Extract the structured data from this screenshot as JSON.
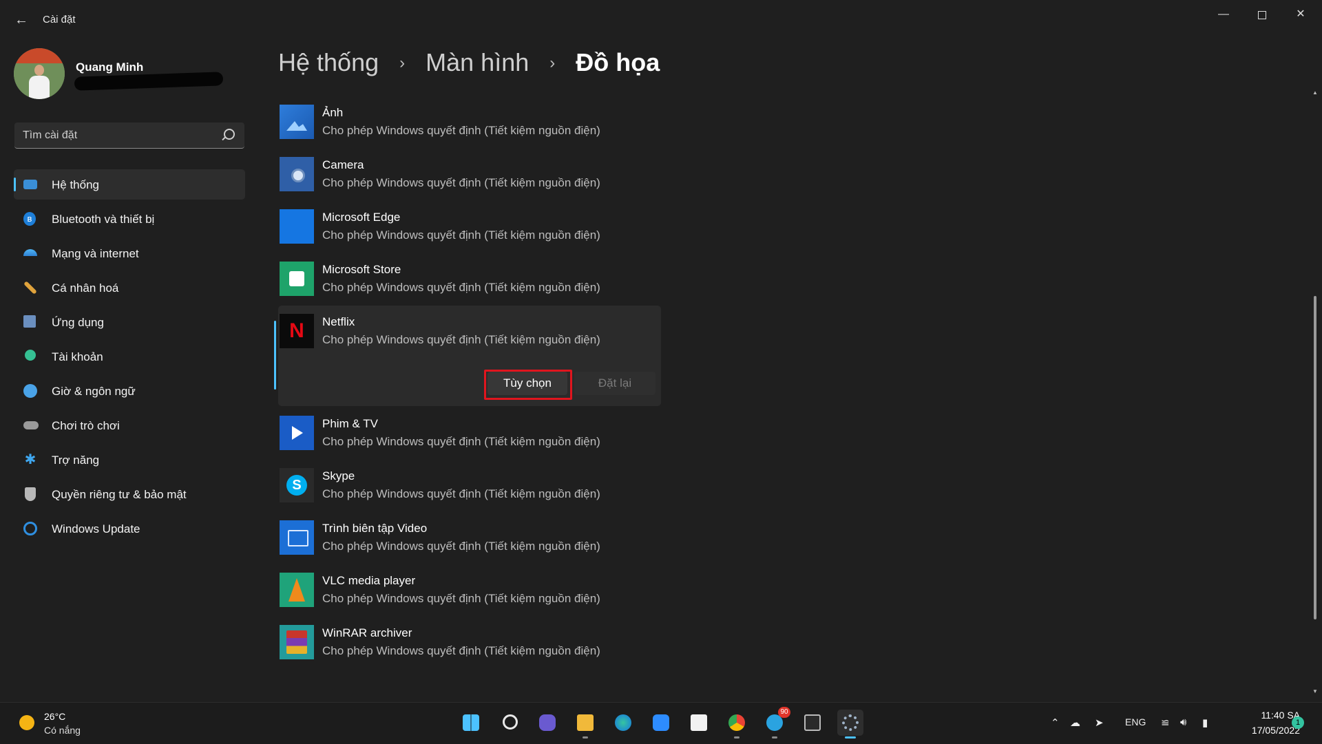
{
  "window": {
    "title": "Cài đặt",
    "back_icon": "arrow-left-icon"
  },
  "profile": {
    "name": "Quang Minh"
  },
  "search": {
    "placeholder": "Tìm cài đặt"
  },
  "sidebar": {
    "items": [
      {
        "label": "Hệ thống",
        "icon": "monitor-icon",
        "active": true
      },
      {
        "label": "Bluetooth và thiết bị",
        "icon": "bluetooth-icon"
      },
      {
        "label": "Mạng và internet",
        "icon": "wifi-icon"
      },
      {
        "label": "Cá nhân hoá",
        "icon": "brush-icon"
      },
      {
        "label": "Ứng dụng",
        "icon": "apps-icon"
      },
      {
        "label": "Tài khoản",
        "icon": "account-icon"
      },
      {
        "label": "Giờ & ngôn ngữ",
        "icon": "globe-clock-icon"
      },
      {
        "label": "Chơi trò chơi",
        "icon": "gamepad-icon"
      },
      {
        "label": "Trợ năng",
        "icon": "accessibility-icon"
      },
      {
        "label": "Quyền riêng tư & bảo mật",
        "icon": "shield-icon"
      },
      {
        "label": "Windows Update",
        "icon": "update-icon"
      }
    ]
  },
  "breadcrumb": {
    "items": [
      "Hệ thống",
      "Màn hình",
      "Đồ họa"
    ]
  },
  "apps": [
    {
      "name": "Ảnh",
      "desc": "Cho phép Windows quyết định (Tiết kiệm nguồn điện)"
    },
    {
      "name": "Camera",
      "desc": "Cho phép Windows quyết định (Tiết kiệm nguồn điện)"
    },
    {
      "name": "Microsoft Edge",
      "desc": "Cho phép Windows quyết định (Tiết kiệm nguồn điện)"
    },
    {
      "name": "Microsoft Store",
      "desc": "Cho phép Windows quyết định (Tiết kiệm nguồn điện)"
    },
    {
      "name": "Netflix",
      "desc": "Cho phép Windows quyết định (Tiết kiệm nguồn điện)",
      "options_label": "Tùy chọn",
      "reset_label": "Đặt lại"
    },
    {
      "name": "Phim & TV",
      "desc": "Cho phép Windows quyết định (Tiết kiệm nguồn điện)"
    },
    {
      "name": "Skype",
      "desc": "Cho phép Windows quyết định (Tiết kiệm nguồn điện)"
    },
    {
      "name": "Trình biên tập Video",
      "desc": "Cho phép Windows quyết định (Tiết kiệm nguồn điện)"
    },
    {
      "name": "VLC media player",
      "desc": "Cho phép Windows quyết định (Tiết kiệm nguồn điện)"
    },
    {
      "name": "WinRAR archiver",
      "desc": "Cho phép Windows quyết định (Tiết kiệm nguồn điện)"
    }
  ],
  "taskbar": {
    "weather": {
      "temp": "26°C",
      "desc": "Có nắng"
    },
    "telegram_badge": "90",
    "language": "ENG",
    "time": "11:40 SA",
    "date": "17/05/2022",
    "notification_count": "1"
  },
  "colors": {
    "accent": "#4cc2ff",
    "highlight_box": "#e0151e",
    "background": "#1f1f1f"
  }
}
